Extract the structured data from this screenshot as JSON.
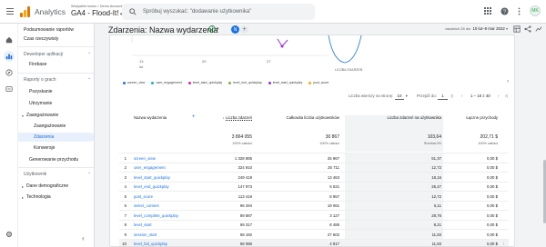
{
  "app": {
    "name": "Analytics",
    "crumb": "Wszystkie konta > Demo Account",
    "property": "GA4 - Flood-It!"
  },
  "search": {
    "placeholder": "Spróbuj wyszukać: \"dodawanie użytkownika\""
  },
  "avatar": {
    "initials": "MK"
  },
  "sidebar": {
    "items": [
      {
        "label": "Podsumowanie raportów"
      },
      {
        "label": "Czas rzeczywisty"
      },
      {
        "label": "Deweloper aplikacji",
        "section": true
      },
      {
        "label": "Firebase"
      },
      {
        "label": "Raporty o grach",
        "section": true
      },
      {
        "label": "Pozyskanie"
      },
      {
        "label": "Utrzymanie"
      },
      {
        "label": "Zaangażowanie"
      },
      {
        "label": "Zaangażowanie"
      },
      {
        "label": "Zdarzenia"
      },
      {
        "label": "Konwersje"
      },
      {
        "label": "Generowanie przychodu"
      },
      {
        "label": "Użytkownik",
        "section": true
      },
      {
        "label": "Dane demograficzne"
      },
      {
        "label": "Technologia"
      }
    ]
  },
  "report": {
    "title": "Zdarzenia: Nazwa wydarzenia",
    "badge": "N",
    "date_prefix": "ostatnich 28 dni",
    "date_range": "10 lut–9 mar 2022"
  },
  "chart_data": {
    "type": "line",
    "x_ticks": [
      "13",
      "20",
      "27"
    ],
    "x_tick_sublabels": [
      "lut",
      "",
      ""
    ],
    "legend_label": "LICZBA ZDARZEŃ",
    "series": [
      {
        "name": "screen_view",
        "color": "#1a73e8"
      },
      {
        "name": "user_engagement",
        "color": "#12b5cb"
      },
      {
        "name": "level_start_quickplay",
        "color": "#e52592"
      },
      {
        "name": "level_end_quickplay",
        "color": "#7cb342"
      },
      {
        "name": "level_start_quickplay",
        "color": "#9334e6"
      },
      {
        "name": "post_score",
        "color": "#f9ab00"
      }
    ]
  },
  "pagination": {
    "rows_label": "Liczba wierszy na stronę:",
    "rows_value": "10",
    "goto_label": "Przejdź do:",
    "goto_value": "1",
    "range": "1 – 10 z 40"
  },
  "table": {
    "headers": [
      "Nazwa wydarzenia",
      "Liczba zdarzeń",
      "Całkowita liczba użytkowników",
      "Liczba zdarzeń na użytkownika",
      "Łączne przychody"
    ],
    "totals": [
      "3 864 055",
      "30 867",
      "103,64",
      "202,71 $"
    ],
    "totals_sub": [
      "100% całości",
      "100% całości",
      "Średnia 0%",
      "100% całości"
    ],
    "rows": [
      {
        "n": "1",
        "name": "screen_view",
        "events": "1 328 985",
        "users": "25 967",
        "per_user": "51,37",
        "revenue": "0,00 $"
      },
      {
        "n": "2",
        "name": "user_engagement",
        "events": "324 910",
        "users": "25 711",
        "per_user": "12,72",
        "revenue": "0,00 $"
      },
      {
        "n": "3",
        "name": "level_start_quickplay",
        "events": "249 419",
        "users": "13 463",
        "per_user": "18,16",
        "revenue": "0,00 $"
      },
      {
        "n": "4",
        "name": "level_end_quickplay",
        "events": "147 973",
        "users": "5 021",
        "per_user": "25,47",
        "revenue": "0,00 $"
      },
      {
        "n": "5",
        "name": "post_score",
        "events": "113 419",
        "users": "8 957",
        "per_user": "12,72",
        "revenue": "0,00 $"
      },
      {
        "n": "6",
        "name": "select_content",
        "events": "96 294",
        "users": "19 061",
        "per_user": "5,11",
        "revenue": "0,00 $"
      },
      {
        "n": "7",
        "name": "level_complete_quickplay",
        "events": "89 887",
        "users": "3 127",
        "per_user": "28,76",
        "revenue": "0,00 $"
      },
      {
        "n": "8",
        "name": "level_start",
        "events": "69 317",
        "users": "8 485",
        "per_user": "8,21",
        "revenue": "0,00 $"
      },
      {
        "n": "9",
        "name": "session_start",
        "events": "68 192",
        "users": "27 602",
        "per_user": "11,83",
        "revenue": "0,00 $"
      },
      {
        "n": "10",
        "name": "level_fail_quickplay",
        "events": "58 086",
        "users": "4 917",
        "per_user": "11,83",
        "revenue": "0,00 $"
      }
    ]
  }
}
